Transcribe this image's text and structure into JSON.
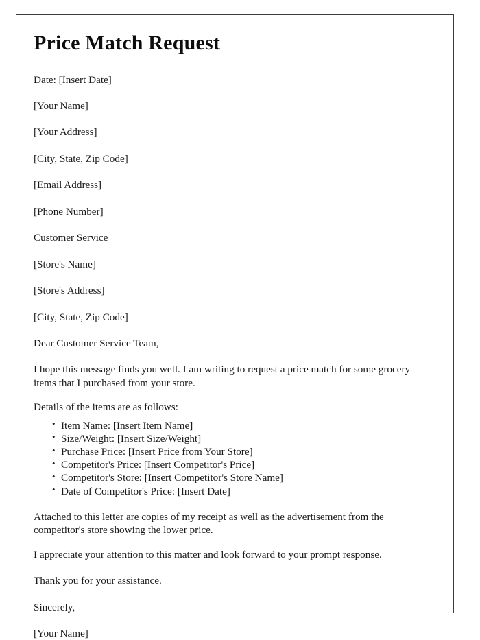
{
  "document": {
    "title": "Price Match Request",
    "date_line": "Date: [Insert Date]",
    "sender": {
      "name": "[Your Name]",
      "address": "[Your Address]",
      "city_state_zip": "[City, State, Zip Code]",
      "email": "[Email Address]",
      "phone": "[Phone Number]"
    },
    "recipient": {
      "department": "Customer Service",
      "store_name": "[Store's Name]",
      "store_address": "[Store's Address]",
      "city_state_zip": "[City, State, Zip Code]"
    },
    "salutation": "Dear Customer Service Team,",
    "intro_paragraph": "I hope this message finds you well. I am writing to request a price match for some grocery items that I purchased from your store.",
    "details_intro": "Details of the items are as follows:",
    "details_list": [
      "Item Name: [Insert Item Name]",
      "Size/Weight: [Insert Size/Weight]",
      "Purchase Price: [Insert Price from Your Store]",
      "Competitor's Price: [Insert Competitor's Price]",
      "Competitor's Store: [Insert Competitor's Store Name]",
      "Date of Competitor's Price: [Insert Date]"
    ],
    "attachment_paragraph": "Attached to this letter are copies of my receipt as well as the advertisement from the competitor's store showing the lower price.",
    "appreciation_paragraph": "I appreciate your attention to this matter and look forward to your prompt response.",
    "thanks_paragraph": "Thank you for your assistance.",
    "closing": "Sincerely,",
    "signature_name": "[Your Name]"
  },
  "style": {
    "page_background": "#ffffff",
    "border_color": "#3c3c3c",
    "text_color": "#1a1a1a"
  }
}
